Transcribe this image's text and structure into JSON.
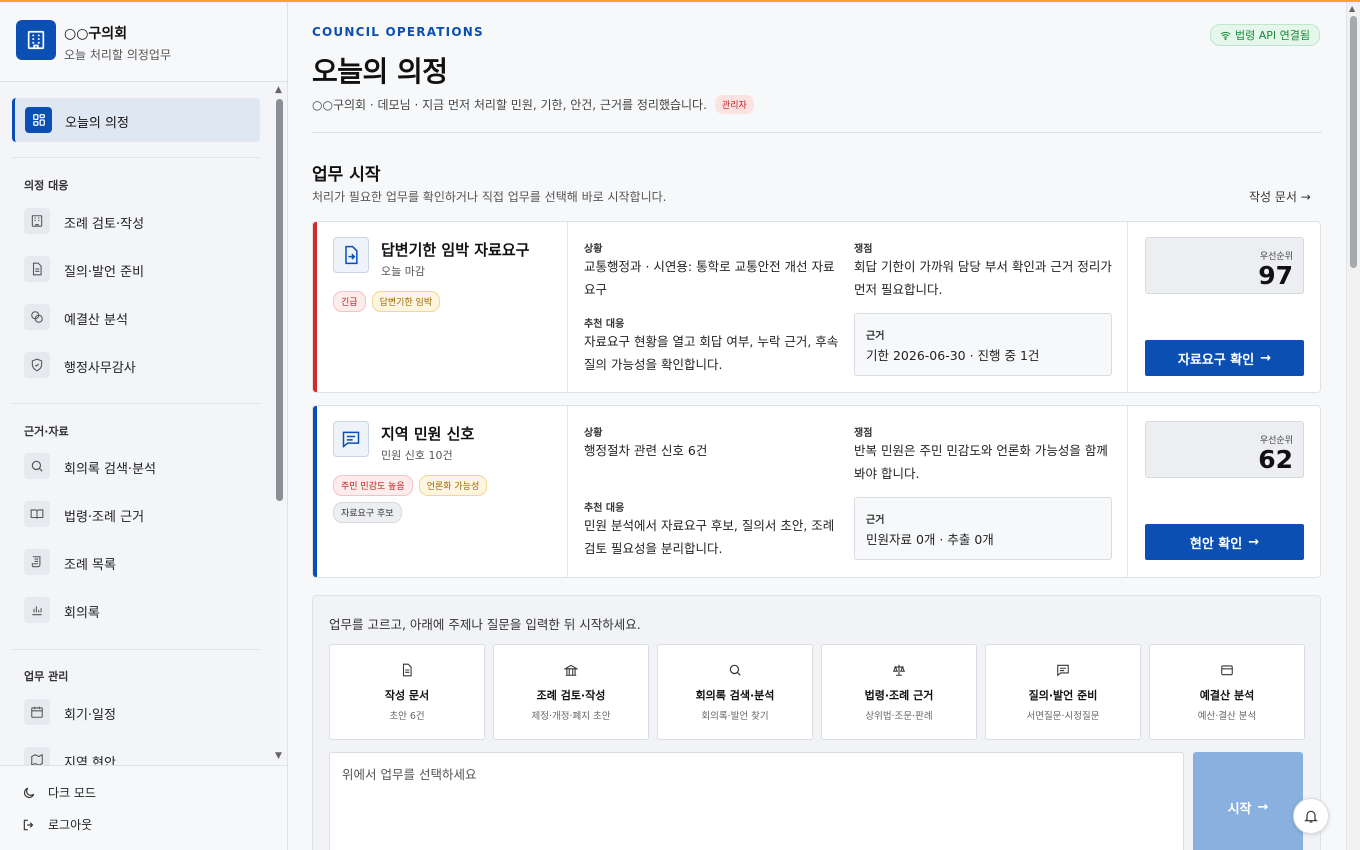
{
  "brand": {
    "name": "○○구의회",
    "sub": "오늘 처리할 의정업무"
  },
  "nav": {
    "active": "오늘의 의정",
    "groups": [
      {
        "heading": "의정 대응",
        "items": [
          "조례 검토·작성",
          "질의·발언 준비",
          "예결산 분석",
          "행정사무감사"
        ]
      },
      {
        "heading": "근거·자료",
        "items": [
          "회의록 검색·분석",
          "법령·조례 근거",
          "조례 목록",
          "회의록"
        ]
      },
      {
        "heading": "업무 관리",
        "items": [
          "회기·일정",
          "지역 현안"
        ]
      }
    ],
    "bottom": [
      "다크 모드",
      "로그아웃"
    ]
  },
  "header": {
    "eyebrow": "COUNCIL OPERATIONS",
    "title": "오늘의 의정",
    "subtitle": "○○구의회 · 데모님 · 지금 먼저 처리할 민원, 기한, 안건, 근거를 정리했습니다.",
    "role_badge": "관리자",
    "api_status": "법령 API 연결됨"
  },
  "section": {
    "title": "업무 시작",
    "subtitle": "처리가 필요한 업무를 확인하거나 직접 업무를 선택해 바로 시작합니다.",
    "link": "작성 문서 →"
  },
  "cards": [
    {
      "title": "답변기한 임박 자료요구",
      "sub": "오늘 마감",
      "tags": [
        {
          "text": "긴급",
          "tone": "red"
        },
        {
          "text": "답변기한 임박",
          "tone": "amber"
        }
      ],
      "situation_label": "상황",
      "situation": "교통행정과 · 시연용: 통학로 교통안전 개선 자료요구",
      "action_label": "추천 대응",
      "action": "자료요구 현황을 열고 회답 여부, 누락 근거, 후속 질의 가능성을 확인합니다.",
      "issue_label": "쟁점",
      "issue": "회답 기한이 가까워 담당 부서 확인과 근거 정리가 먼저 필요합니다.",
      "evidence_label": "근거",
      "evidence": "기한 2026-06-30 · 진행 중 1건",
      "priority_label": "우선순위",
      "priority": "97",
      "cta": "자료요구 확인",
      "accent": "#d62828"
    },
    {
      "title": "지역 민원 신호",
      "sub": "민원 신호 10건",
      "tags": [
        {
          "text": "주민 민감도 높음",
          "tone": "red"
        },
        {
          "text": "언론화 가능성",
          "tone": "amber"
        },
        {
          "text": "자료요구 후보",
          "tone": "gray"
        }
      ],
      "situation_label": "상황",
      "situation": "행정절차 관련 신호 6건",
      "action_label": "추천 대응",
      "action": "민원 분석에서 자료요구 후보, 질의서 초안, 조례 검토 필요성을 분리합니다.",
      "issue_label": "쟁점",
      "issue": "반복 민원은 주민 민감도와 언론화 가능성을 함께 봐야 합니다.",
      "evidence_label": "근거",
      "evidence": "민원자료 0개 · 추출 0개",
      "priority_label": "우선순위",
      "priority": "62",
      "cta": "현안 확인",
      "accent": "#0b4fb3"
    }
  ],
  "launcher": {
    "hint": "업무를 고르고, 아래에 주제나 질문을 입력한 뒤 시작하세요.",
    "tiles": [
      {
        "title": "작성 문서",
        "sub": "초안 6건",
        "icon": "document-icon"
      },
      {
        "title": "조례 검토·작성",
        "sub": "제정·개정·폐지 초안",
        "icon": "building-icon"
      },
      {
        "title": "회의록 검색·분석",
        "sub": "회의록·발언 찾기",
        "icon": "search-icon"
      },
      {
        "title": "법령·조례 근거",
        "sub": "상위법·조문·판례",
        "icon": "scale-icon"
      },
      {
        "title": "질의·발언 준비",
        "sub": "서면질문·시정질문",
        "icon": "message-icon"
      },
      {
        "title": "예결산 분석",
        "sub": "예산·결산 분석",
        "icon": "wallet-icon"
      }
    ],
    "input_placeholder": "위에서 업무를 선택하세요",
    "start": "시작"
  },
  "colors": {
    "primary": "#0b4fb3",
    "urgent": "#d62828",
    "top_line": "#f5a524"
  }
}
